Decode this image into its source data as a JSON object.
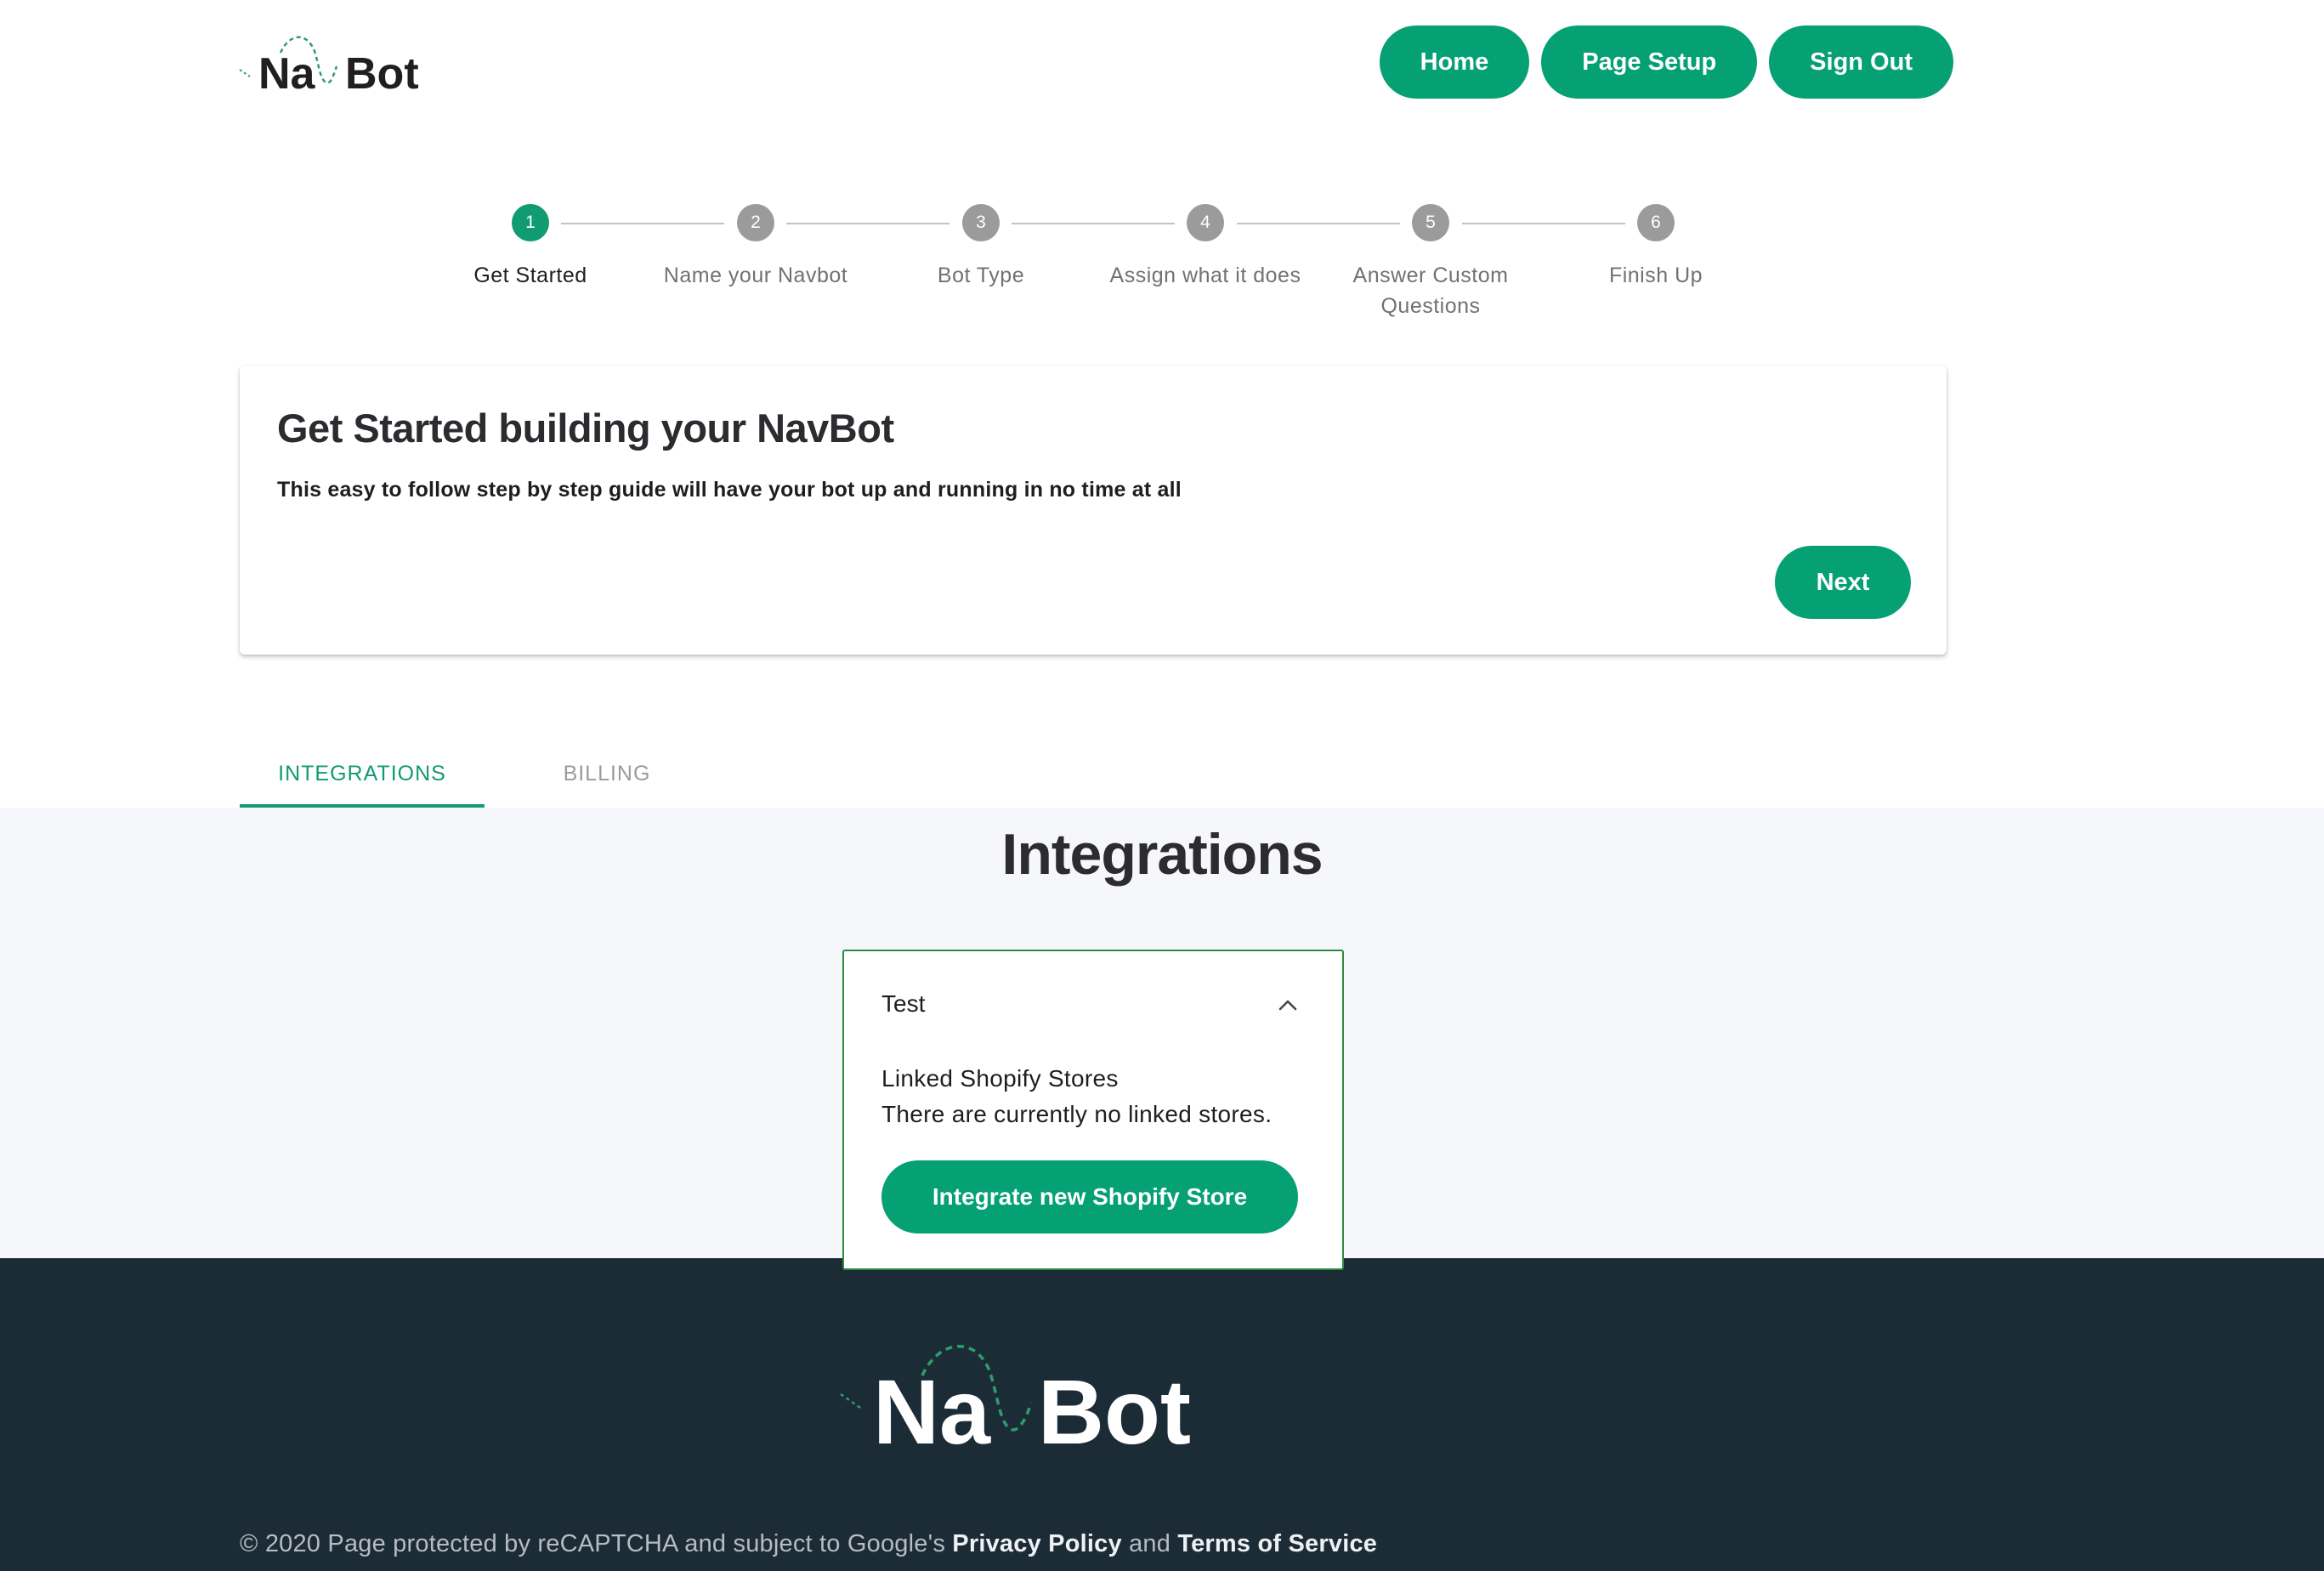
{
  "header": {
    "logo_text_dark": "Na",
    "logo_text_dark2": "Bot",
    "nav": [
      {
        "label": "Home"
      },
      {
        "label": "Page Setup"
      },
      {
        "label": "Sign Out"
      }
    ]
  },
  "stepper": {
    "steps": [
      {
        "number": "1",
        "label": "Get Started",
        "active": true
      },
      {
        "number": "2",
        "label": "Name your Navbot",
        "active": false
      },
      {
        "number": "3",
        "label": "Bot Type",
        "active": false
      },
      {
        "number": "4",
        "label": "Assign what it does",
        "active": false
      },
      {
        "number": "5",
        "label": "Answer Custom Questions",
        "active": false
      },
      {
        "number": "6",
        "label": "Finish Up",
        "active": false
      }
    ]
  },
  "card": {
    "title": "Get Started building your NavBot",
    "description": "This easy to follow step by step guide will have your bot up and running in no time at all",
    "next_label": "Next"
  },
  "tabs": [
    {
      "label": "INTEGRATIONS",
      "active": true
    },
    {
      "label": "BILLING",
      "active": false
    }
  ],
  "integrations": {
    "title": "Integrations",
    "item": {
      "name": "Test",
      "linked_label": "Linked Shopify Stores",
      "empty_message": "There are currently no linked stores.",
      "button_label": "Integrate new Shopify Store"
    }
  },
  "footer": {
    "prefix": "© 2020 Page protected by reCAPTCHA and subject to Google's",
    "privacy": "Privacy Policy",
    "and": "and",
    "terms": "Terms of Service"
  },
  "colors": {
    "brand_green": "#05a074",
    "footer_bg": "#1c2c37",
    "panel_bg": "#f6f7fa"
  }
}
